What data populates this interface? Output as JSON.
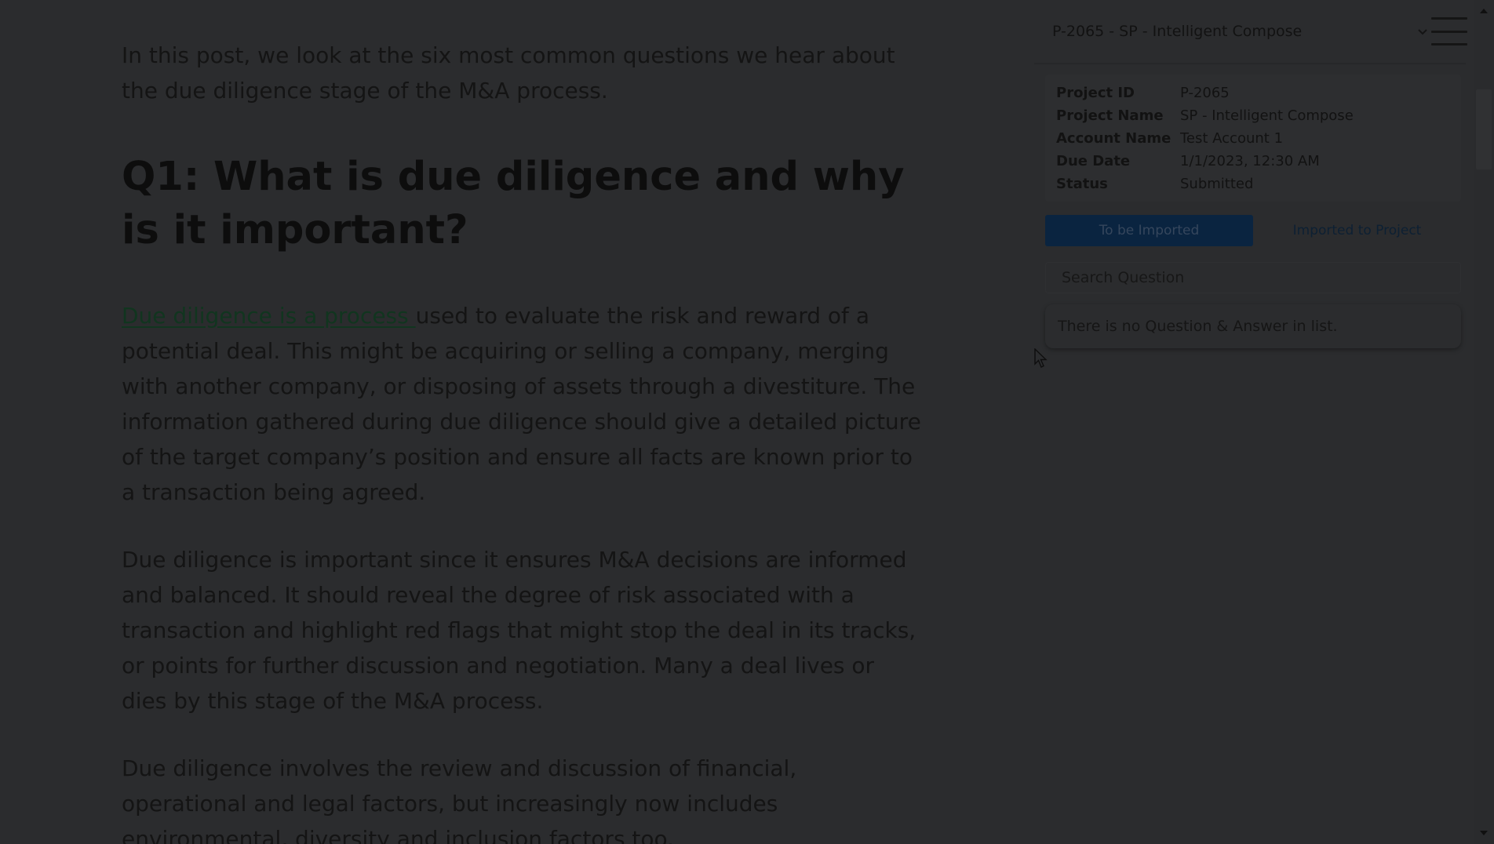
{
  "article": {
    "intro": "In this post, we look at the six most common questions we hear about the due diligence stage of the M&A process.",
    "heading": "Q1: What is due diligence and why is it important?",
    "para1_link": "Due diligence is a process ",
    "para1_rest": "used to evaluate the risk and reward of a potential deal. This might be acquiring or selling a company, merging with another company, or disposing of assets through a divestiture. The information gathered during due diligence should give a detailed picture of the target company’s position and ensure all facts are known prior to a transaction being agreed.",
    "para2": "Due diligence is important since it ensures M&A decisions are informed and balanced. It should reveal the degree of risk associated with a transaction and highlight red flags that might stop the deal in its tracks, or points for further discussion and negotiation. Many a deal lives or dies by this stage of the M&A process.",
    "para3": "Due diligence involves the review and discussion of financial, operational and legal factors, but increasingly now includes environmental, diversity and inclusion factors too."
  },
  "panel": {
    "project_select": "P-2065 - SP - Intelligent Compose",
    "icons": {
      "dropdown": "chevron-down-icon",
      "menu": "hamburger-menu-icon"
    },
    "info": {
      "project_id_label": "Project ID",
      "project_id": "P-2065",
      "project_name_label": "Project Name",
      "project_name": "SP - Intelligent Compose",
      "account_name_label": "Account Name",
      "account_name": "Test Account 1",
      "due_date_label": "Due Date",
      "due_date": "1/1/2023, 12:30 AM",
      "status_label": "Status",
      "status": "Submitted"
    },
    "tabs": [
      {
        "label": "To be Imported",
        "active": true
      },
      {
        "label": "Imported to Project",
        "active": false
      }
    ],
    "search": {
      "placeholder": "Search Question",
      "value": ""
    },
    "empty_message": "There is no Question & Answer in list."
  },
  "colors": {
    "overlay_background": "#2b2c2e",
    "active_tab": "#0a2440",
    "link": "#11351f"
  }
}
